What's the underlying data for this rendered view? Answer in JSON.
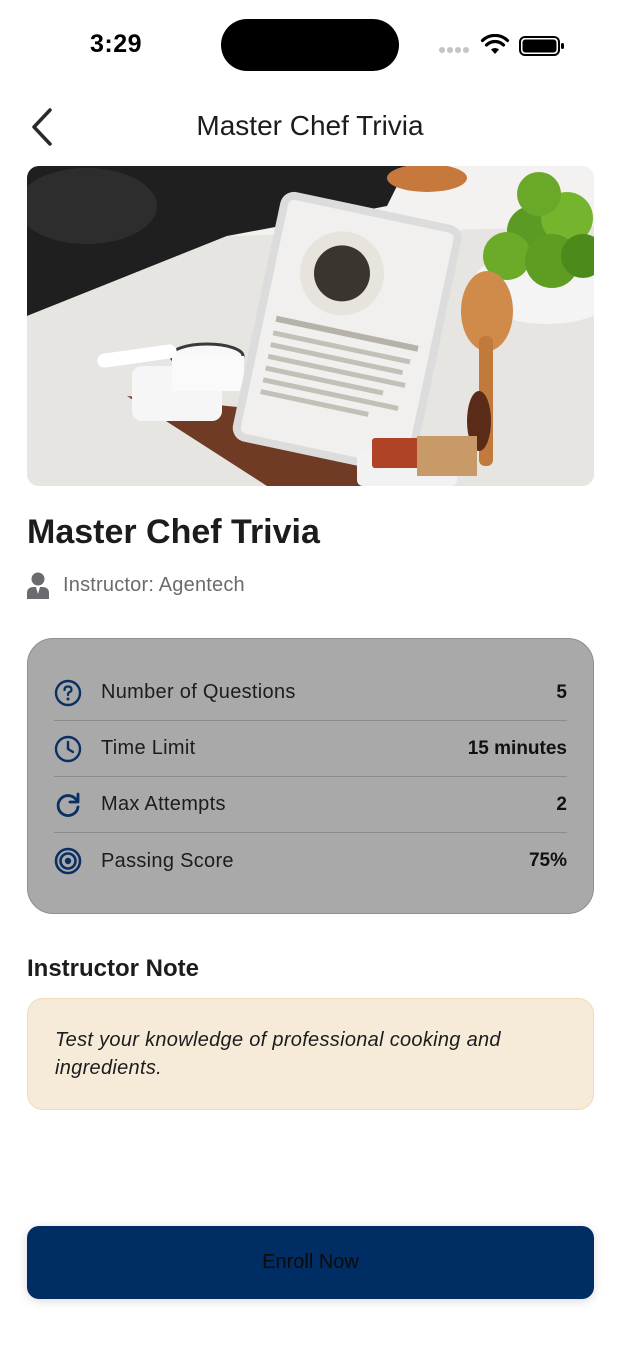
{
  "status_bar": {
    "time": "3:29"
  },
  "nav": {
    "title": "Master Chef Trivia",
    "back_icon": "chevron-left-icon"
  },
  "hero": {
    "description_icon": "photo"
  },
  "quiz": {
    "title": "Master Chef Trivia",
    "instructor": "Instructor: Agentech"
  },
  "details": [
    {
      "icon": "question-circle-icon",
      "label": "Number of Questions",
      "value": "5"
    },
    {
      "icon": "clock-icon",
      "label": "Time Limit",
      "value": "15 minutes"
    },
    {
      "icon": "refresh-icon",
      "label": "Max Attempts",
      "value": "2"
    },
    {
      "icon": "target-icon",
      "label": "Passing Score",
      "value": "75%"
    }
  ],
  "note": {
    "heading": "Instructor Note",
    "text": "Test your knowledge of professional cooking and ingredients."
  },
  "actions": {
    "enroll_label": "Enroll Now"
  },
  "colors": {
    "accent": "#002d63",
    "card_bg": "#a9a9a9",
    "note_bg": "#f6ebd8",
    "icon_color": "#0a2f63"
  }
}
